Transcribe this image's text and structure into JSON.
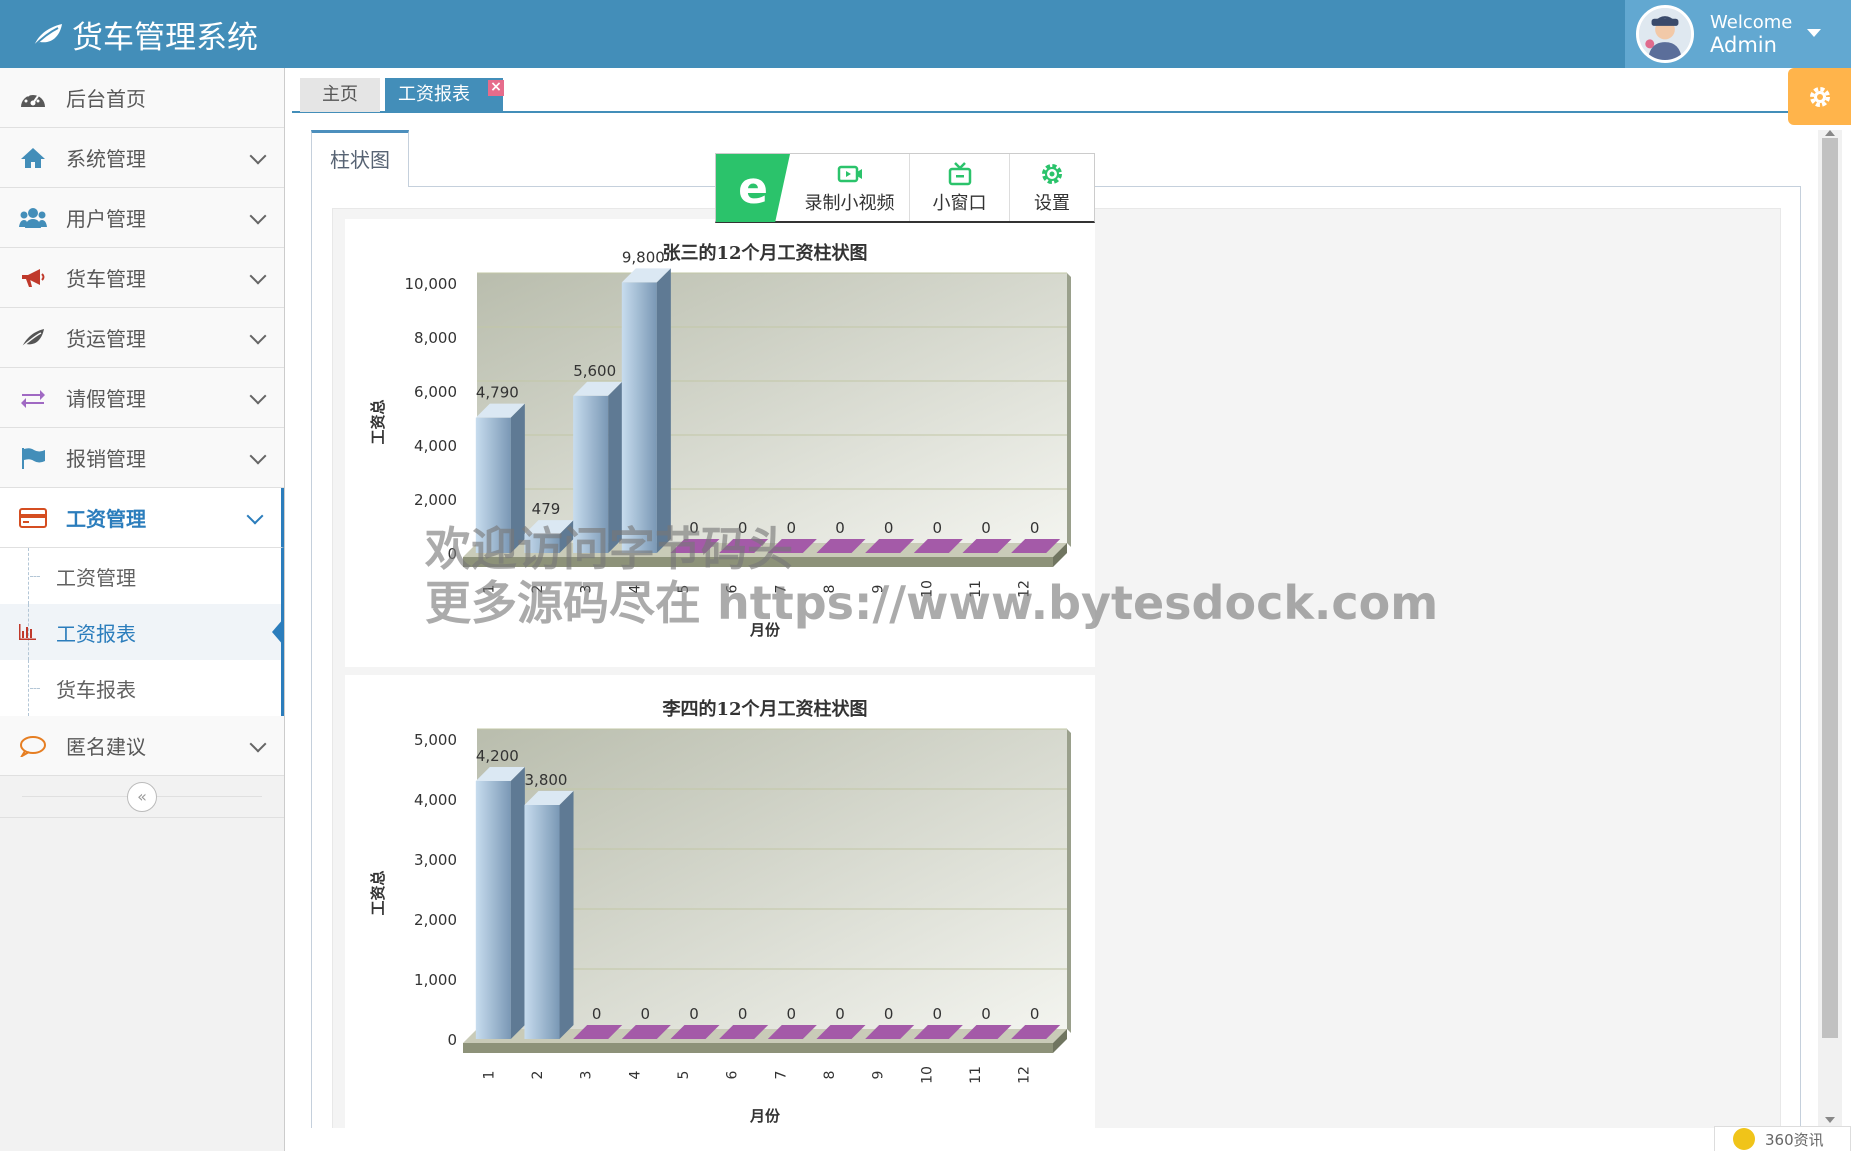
{
  "app": {
    "title": "货车管理系统"
  },
  "user": {
    "welcome": "Welcome",
    "name": "Admin"
  },
  "sidebar": {
    "items": [
      {
        "label": "后台首页",
        "icon": "dashboard-icon"
      },
      {
        "label": "系统管理",
        "icon": "home-icon"
      },
      {
        "label": "用户管理",
        "icon": "users-icon"
      },
      {
        "label": "货车管理",
        "icon": "bullhorn-icon"
      },
      {
        "label": "货运管理",
        "icon": "leaf-icon"
      },
      {
        "label": "请假管理",
        "icon": "exchange-icon"
      },
      {
        "label": "报销管理",
        "icon": "flag-icon"
      },
      {
        "label": "工资管理",
        "icon": "credit-card-icon"
      },
      {
        "label": "匿名建议",
        "icon": "comment-icon"
      }
    ],
    "sub_items": [
      {
        "label": "工资管理"
      },
      {
        "label": "工资报表"
      },
      {
        "label": "货车报表"
      }
    ],
    "collapse_label": "«"
  },
  "tabs": [
    {
      "label": "主页"
    },
    {
      "label": "工资报表"
    }
  ],
  "inner_tab": {
    "label": "柱状图"
  },
  "toolbar360": {
    "record": "录制小视频",
    "mini_window": "小窗口",
    "settings": "设置"
  },
  "watermark": {
    "line1": "欢迎访问字节码头",
    "line2": "更多源码尽在 https://www.bytesdock.com"
  },
  "news": {
    "label": "360资讯"
  },
  "colors": {
    "header": "#438eb9",
    "accent": "#2b7dbc",
    "settings": "#ffb44b"
  },
  "chart_data": [
    {
      "type": "bar",
      "title": "张三的12个月工资柱状图",
      "xlabel": "月份",
      "ylabel": "工资总",
      "categories": [
        "1",
        "2",
        "3",
        "4",
        "5",
        "6",
        "7",
        "8",
        "9",
        "10",
        "11",
        "12"
      ],
      "values": [
        4790,
        479,
        5600,
        9800,
        0,
        0,
        0,
        0,
        0,
        0,
        0,
        0
      ],
      "ylim": [
        0,
        10000
      ],
      "yticks": [
        "0",
        "2,000",
        "4,000",
        "6,000",
        "8,000",
        "10,000"
      ],
      "value_labels": [
        "4,790",
        "479",
        "5,600",
        "9,800",
        "0",
        "0",
        "0",
        "0",
        "0",
        "0",
        "0",
        "0"
      ]
    },
    {
      "type": "bar",
      "title": "李四的12个月工资柱状图",
      "xlabel": "月份",
      "ylabel": "工资总",
      "categories": [
        "1",
        "2",
        "3",
        "4",
        "5",
        "6",
        "7",
        "8",
        "9",
        "10",
        "11",
        "12"
      ],
      "values": [
        4200,
        3800,
        0,
        0,
        0,
        0,
        0,
        0,
        0,
        0,
        0,
        0
      ],
      "ylim": [
        0,
        5000
      ],
      "yticks": [
        "0",
        "1,000",
        "2,000",
        "3,000",
        "4,000",
        "5,000"
      ],
      "value_labels": [
        "4,200",
        "3,800",
        "0",
        "0",
        "0",
        "0",
        "0",
        "0",
        "0",
        "0",
        "0",
        "0"
      ]
    }
  ]
}
